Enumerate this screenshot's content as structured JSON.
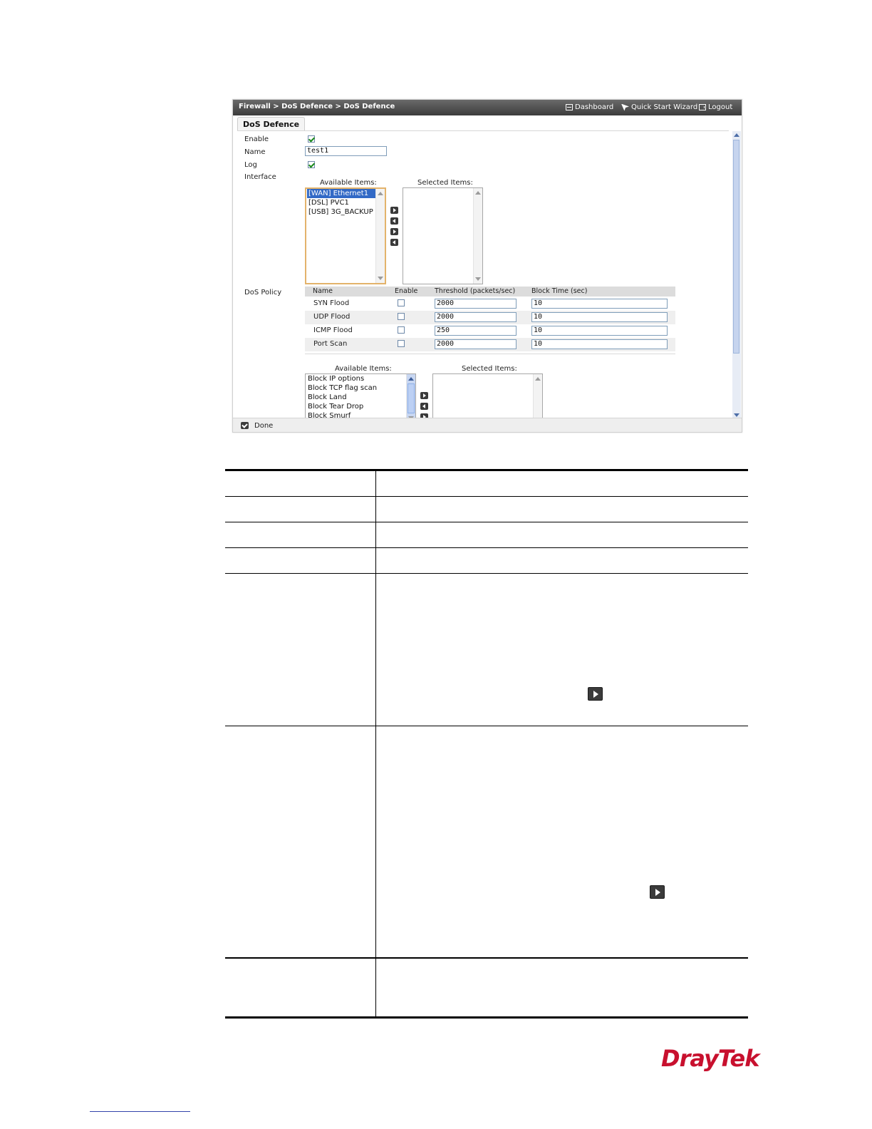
{
  "window": {
    "breadcrumb": "Firewall > DoS Defence > DoS Defence",
    "nav": {
      "dashboard": "Dashboard",
      "wizard": "Quick Start Wizard",
      "logout": "Logout"
    },
    "tab": "DoS Defence"
  },
  "form": {
    "enable_label": "Enable",
    "enable_checked": true,
    "name_label": "Name",
    "name_value": "test1",
    "log_label": "Log",
    "log_checked": true,
    "interface_label": "Interface"
  },
  "interface": {
    "available_label": "Available Items:",
    "selected_label": "Selected Items:",
    "available_items": [
      "[WAN] Ethernet1",
      "[DSL] PVC1",
      "[USB] 3G_BACKUP"
    ],
    "selected_index": 0
  },
  "dos_policy": {
    "label": "DoS Policy",
    "headers": [
      "Name",
      "Enable",
      "Threshold (packets/sec)",
      "Block Time (sec)"
    ],
    "rows": [
      {
        "name": "SYN Flood",
        "enabled": false,
        "threshold": "2000",
        "block_time": "10"
      },
      {
        "name": "UDP Flood",
        "enabled": false,
        "threshold": "2000",
        "block_time": "10"
      },
      {
        "name": "ICMP Flood",
        "enabled": false,
        "threshold": "250",
        "block_time": "10"
      },
      {
        "name": "Port Scan",
        "enabled": false,
        "threshold": "2000",
        "block_time": "10"
      }
    ]
  },
  "block": {
    "available_label": "Available Items:",
    "selected_label": "Selected Items:",
    "available_items": [
      "Block IP options",
      "Block TCP flag scan",
      "Block Land",
      "Block Tear Drop",
      "Block Smurf"
    ]
  },
  "footer": {
    "done": "Done"
  },
  "brand": {
    "logo": "DrayTek",
    "logo_color": "#c8102e"
  }
}
